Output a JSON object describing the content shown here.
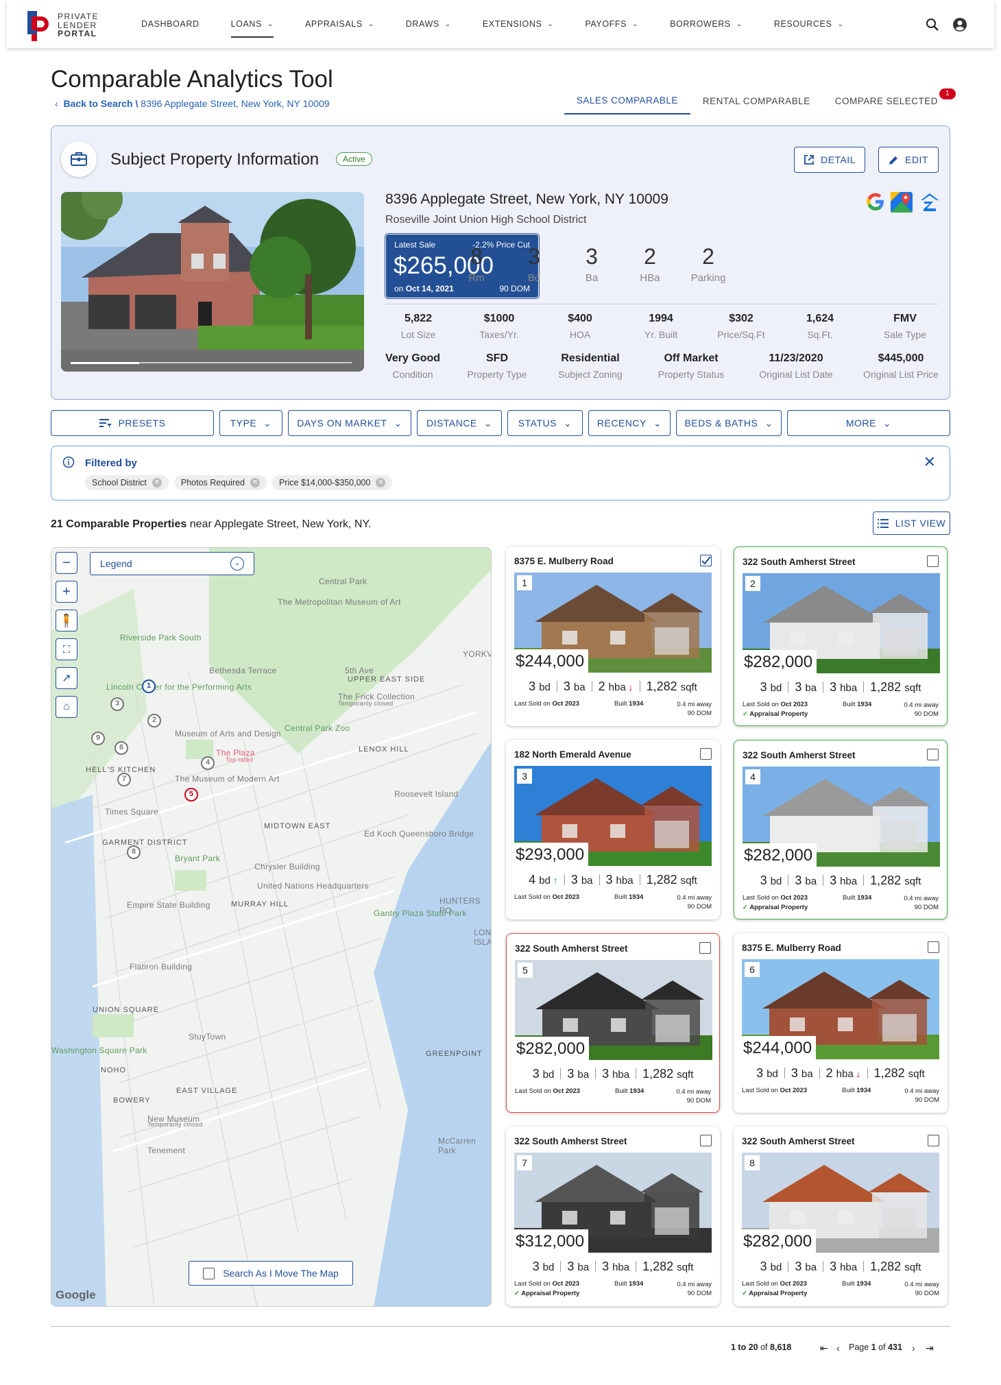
{
  "brand": {
    "line1": "PRIVATE",
    "line2": "LENDER",
    "line3": "PORTAL"
  },
  "nav": [
    {
      "label": "DASHBOARD",
      "chev": false,
      "active": false
    },
    {
      "label": "LOANS",
      "chev": true,
      "active": true
    },
    {
      "label": "APPRAISALS",
      "chev": true,
      "active": false
    },
    {
      "label": "DRAWS",
      "chev": true,
      "active": false
    },
    {
      "label": "EXTENSIONS",
      "chev": true,
      "active": false
    },
    {
      "label": "PAYOFFS",
      "chev": true,
      "active": false
    },
    {
      "label": "BORROWERS",
      "chev": true,
      "active": false
    },
    {
      "label": "RESOURCES",
      "chev": true,
      "active": false
    }
  ],
  "page": {
    "title": "Comparable Analytics Tool",
    "back": "Back to Search \\",
    "crumb_addr": "8396 Applegate Street, New York, NY 10009"
  },
  "tabs": {
    "sales": "SALES COMPARABLE",
    "rental": "RENTAL COMPARABLE",
    "compare": "COMPARE SELECTED",
    "compare_count": "1"
  },
  "subject": {
    "title": "Subject Property Information",
    "status": "Active",
    "detail_btn": "DETAIL",
    "edit_btn": "EDIT",
    "address": "8396 Applegate Street, New York, NY 10009",
    "district": "Roseville Joint Union High School District",
    "sale": {
      "label": "Latest Sale",
      "cut": "-2.2% Price Cut",
      "price": "$265,000",
      "date_prefix": "on",
      "date": "Oct 14, 2021",
      "dom": "90 DOM"
    },
    "big": [
      {
        "v": "8",
        "l": "Rm"
      },
      {
        "v": "3",
        "l": "Bd"
      },
      {
        "v": "3",
        "l": "Ba"
      },
      {
        "v": "2",
        "l": "HBa"
      },
      {
        "v": "2",
        "l": "Parking"
      }
    ],
    "row1": [
      {
        "v": "5,822",
        "l": "Lot Size"
      },
      {
        "v": "$1000",
        "l": "Taxes/Yr."
      },
      {
        "v": "$400",
        "l": "HOA"
      },
      {
        "v": "1994",
        "l": "Yr. Built"
      },
      {
        "v": "$302",
        "l": "Price/Sq.Ft"
      },
      {
        "v": "1,624",
        "l": "Sq.Ft."
      },
      {
        "v": "FMV",
        "l": "Sale Type"
      }
    ],
    "row2": [
      {
        "v": "Very Good",
        "l": "Condition"
      },
      {
        "v": "SFD",
        "l": "Property Type"
      },
      {
        "v": "Residential",
        "l": "Subject Zoning"
      },
      {
        "v": "Off Market",
        "l": "Property Status"
      },
      {
        "v": "11/23/2020",
        "l": "Original List Date"
      },
      {
        "v": "$445,000",
        "l": "Original List Price"
      }
    ]
  },
  "filters": {
    "presets": "PRESETS",
    "type": "TYPE",
    "dom": "DAYS ON MARKET",
    "distance": "DISTANCE",
    "status": "STATUS",
    "recency": "RECENCY",
    "beds": "BEDS & BATHS",
    "more": "MORE"
  },
  "filtered": {
    "label": "Filtered by",
    "chips": [
      "School District",
      "Photos Required",
      "Price $14,000-$350,000"
    ]
  },
  "results": {
    "count": "21 Comparable Properties",
    "near": "near Applegate Street, New York, NY.",
    "list_view": "LIST VIEW"
  },
  "map": {
    "legend": "Legend",
    "search_toggle": "Search As I Move The Map",
    "google": "Google",
    "labels": [
      "Central Park",
      "The Metropolitan Museum of Art",
      "Riverside Park South",
      "Bethesda Terrace",
      "5th Ave",
      "YORKVIL",
      "UPPER EAST SIDE",
      "Lincoln Center for the Performing Arts",
      "The Frick Collection",
      "Temporarily closed",
      "Central Park Zoo",
      "Museum of Arts and Design",
      "LENOX HILL",
      "The Plaza",
      "Top rated",
      "HELL'S KITCHEN",
      "The Museum of Modern Art",
      "Roosevelt Island",
      "Times Square",
      "MIDTOWN EAST",
      "Ed Koch Queensboro Bridge",
      "GARMENT DISTRICT",
      "Bryant Park",
      "Chrysler Building",
      "United Nations Headquarters",
      "Empire State Building",
      "MURRAY HILL",
      "HUNTERS PO",
      "Gantry Plaza State Park",
      "LONG ISLAND",
      "Flatiron Building",
      "UNION SQUARE",
      "StuyTown",
      "Washington Square Park",
      "GREENPOINT",
      "NOHO",
      "EAST VILLAGE",
      "BOWERY",
      "New Museum",
      "Temporarily closed",
      "McCarren Park",
      "Tenement"
    ],
    "pins": [
      "1",
      "2",
      "3",
      "4",
      "5",
      "6",
      "7",
      "8",
      "9"
    ]
  },
  "cards": [
    {
      "n": "1",
      "addr": "8375 E. Mulberry Road",
      "price": "$244,000",
      "bd": "3",
      "ba": "3",
      "hba": "2",
      "sqft": "1,282",
      "hba_down": true,
      "bd_up": false,
      "sold": "Oct 2023",
      "built": "1934",
      "dist": "0.4 mi away",
      "dom": "90 DOM",
      "appraisal": "",
      "checked": true,
      "border": "none"
    },
    {
      "n": "2",
      "addr": "322 South Amherst Street",
      "price": "$282,000",
      "bd": "3",
      "ba": "3",
      "hba": "3",
      "sqft": "1,282",
      "hba_down": false,
      "bd_up": false,
      "sold": "Oct 2023",
      "built": "1934",
      "dist": "0.4 mi away",
      "dom": "90 DOM",
      "appraisal": "Appraisal Property",
      "checked": false,
      "border": "green"
    },
    {
      "n": "3",
      "addr": "182 North Emerald Avenue",
      "price": "$293,000",
      "bd": "4",
      "ba": "3",
      "hba": "3",
      "sqft": "1,282",
      "hba_down": false,
      "bd_up": true,
      "sold": "Oct 2023",
      "built": "1934",
      "dist": "0.4 mi away",
      "dom": "90 DOM",
      "appraisal": "",
      "checked": false,
      "border": "none"
    },
    {
      "n": "4",
      "addr": "322 South Amherst Street",
      "price": "$282,000",
      "bd": "3",
      "ba": "3",
      "hba": "3",
      "sqft": "1,282",
      "hba_down": false,
      "bd_up": false,
      "sold": "Oct 2023",
      "built": "1934",
      "dist": "0.4 mi away",
      "dom": "90 DOM",
      "appraisal": "Appraisal Property",
      "checked": false,
      "border": "green"
    },
    {
      "n": "5",
      "addr": "322 South Amherst Street",
      "price": "$282,000",
      "bd": "3",
      "ba": "3",
      "hba": "3",
      "sqft": "1,282",
      "hba_down": false,
      "bd_up": false,
      "sold": "Oct 2023",
      "built": "1934",
      "dist": "0.4 mi away",
      "dom": "90 DOM",
      "appraisal": "",
      "checked": false,
      "border": "red"
    },
    {
      "n": "6",
      "addr": "8375 E. Mulberry Road",
      "price": "$244,000",
      "bd": "3",
      "ba": "3",
      "hba": "2",
      "sqft": "1,282",
      "hba_down": true,
      "bd_up": false,
      "sold": "Oct 2023",
      "built": "1934",
      "dist": "0.4 mi away",
      "dom": "90 DOM",
      "appraisal": "",
      "checked": false,
      "border": "none"
    },
    {
      "n": "7",
      "addr": "322 South Amherst Street",
      "price": "$312,000",
      "bd": "3",
      "ba": "3",
      "hba": "3",
      "sqft": "1,282",
      "hba_down": false,
      "bd_up": false,
      "sold": "Oct 2023",
      "built": "1934",
      "dist": "0.4 mi away",
      "dom": "90 DOM",
      "appraisal": "Appraisal Property",
      "checked": false,
      "border": "none"
    },
    {
      "n": "8",
      "addr": "322 South Amherst Street",
      "price": "$282,000",
      "bd": "3",
      "ba": "3",
      "hba": "3",
      "sqft": "1,282",
      "hba_down": false,
      "bd_up": false,
      "sold": "Oct 2023",
      "built": "1934",
      "dist": "0.4 mi away",
      "dom": "90 DOM",
      "appraisal": "Appraisal Property",
      "checked": false,
      "border": "none"
    }
  ],
  "card_text": {
    "bd": "bd",
    "ba": "ba",
    "hba": "hba",
    "sqft": "sqft",
    "sold_prefix": "Last Sold on",
    "built_prefix": "Built"
  },
  "pager": {
    "range": "1 to 20",
    "of": "of",
    "total": "8,618",
    "page": "Page",
    "cur": "1",
    "of2": "of",
    "pages": "431"
  },
  "colors": {
    "primary": "#1f4e9a",
    "appraisal": "#4caf50",
    "selected_red": "#e04a4a",
    "badge": "#d0021b"
  }
}
